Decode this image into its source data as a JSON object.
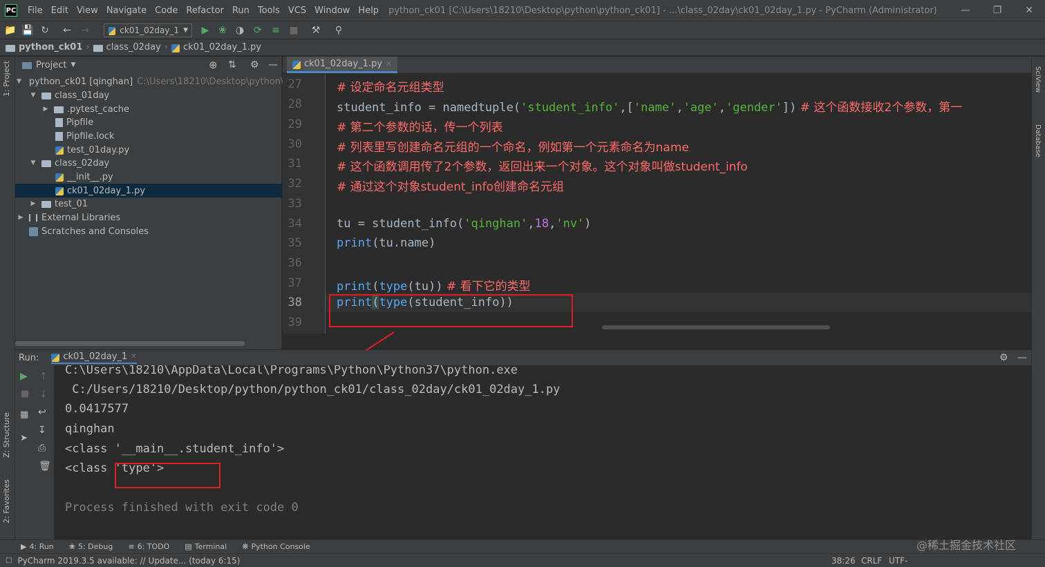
{
  "window": {
    "title": "python_ck01 [C:\\Users\\18210\\Desktop\\python\\python_ck01] - ...\\class_02day\\ck01_02day_1.py - PyCharm (Administrator)",
    "menu": [
      "File",
      "Edit",
      "View",
      "Navigate",
      "Code",
      "Refactor",
      "Run",
      "Tools",
      "VCS",
      "Window",
      "Help"
    ]
  },
  "toolbar": {
    "run_config": "ck01_02day_1"
  },
  "breadcrumb": [
    "python_ck01",
    "class_02day",
    "ck01_02day_1.py"
  ],
  "left_stripe": {
    "project_tab": "1: Project",
    "structure_tab": "Z: Structure",
    "favorites_tab": "2: Favorites"
  },
  "project": {
    "header": "Project",
    "tree": [
      {
        "label": "python_ck01 [qinghan]",
        "hint": "C:\\Users\\18210\\Desktop\\python\\py"
      },
      {
        "label": "class_01day"
      },
      {
        "label": ".pytest_cache"
      },
      {
        "label": "Pipfile"
      },
      {
        "label": "Pipfile.lock"
      },
      {
        "label": "test_01day.py"
      },
      {
        "label": "class_02day"
      },
      {
        "label": "__init__.py"
      },
      {
        "label": "ck01_02day_1.py"
      },
      {
        "label": "test_01"
      },
      {
        "label": "External Libraries"
      },
      {
        "label": "Scratches and Consoles"
      }
    ]
  },
  "editor": {
    "tab": "ck01_02day_1.py",
    "line_numbers": [
      "27",
      "28",
      "29",
      "30",
      "31",
      "32",
      "33",
      "34",
      "35",
      "36",
      "37",
      "38",
      "39"
    ],
    "lines": {
      "l27": "# 设定命名元组类型",
      "l28a": "student_info = namedtuple(",
      "l28b": "'student_info'",
      "l28c": ",[",
      "l28d": "'name'",
      "l28e": ",",
      "l28f": "'age'",
      "l28g": ",",
      "l28h": "'gender'",
      "l28i": "])",
      "l28j": " # 这个函数接收2个参数，第一",
      "l29": "# 第二个参数的话，传一个列表",
      "l30": "# 列表里写创建命名元组的一个命名，例如第一个元素命名为name",
      "l31": "# 这个函数调用传了2个参数，返回出来一个对象。这个对象叫做student_info",
      "l32": "# 通过这个对象student_info创建命名元组",
      "l34a": "tu = student_info(",
      "l34b": "'qinghan'",
      "l34c": ",",
      "l34d": "18",
      "l34e": ",",
      "l34f": "'nv'",
      "l34g": ")",
      "l35a": "print",
      "l35b": "(tu.name)",
      "l37a": "print",
      "l37b": "(",
      "l37c": "type",
      "l37d": "(tu))",
      "l37e": " # 看下它的类型",
      "l38a": "print",
      "l38b": "(",
      "l38c": "type",
      "l38d": "(student_info))"
    }
  },
  "run": {
    "label": "Run:",
    "tab": "ck01_02day_1",
    "output": [
      "C:\\Users\\18210\\AppData\\Local\\Programs\\Python\\Python37\\python.exe",
      " C:/Users/18210/Desktop/python/python_ck01/class_02day/ck01_02day_1.py",
      "0.0417577",
      "qinghan",
      "<class '__main__.student_info'>",
      "<class 'type'>",
      "",
      "Process finished with exit code 0"
    ]
  },
  "bottom_tabs": [
    "4: Run",
    "5: Debug",
    "6: TODO",
    "Terminal",
    "Python Console"
  ],
  "status": {
    "message": "PyCharm 2019.3.5 available: // Update... (today 6:15)",
    "position": "38:26",
    "line_sep": "CRLF",
    "encoding": "UTF-"
  },
  "right_stripe": {
    "sciview": "SciView",
    "database": "Database"
  },
  "watermark": "@稀土掘金技术社区",
  "colors": {
    "annotation": "#e02020",
    "selection": "#0d293e",
    "keyword_fn": "#56a8f5",
    "string": "#55b53b",
    "comment": "#ff6b68"
  }
}
